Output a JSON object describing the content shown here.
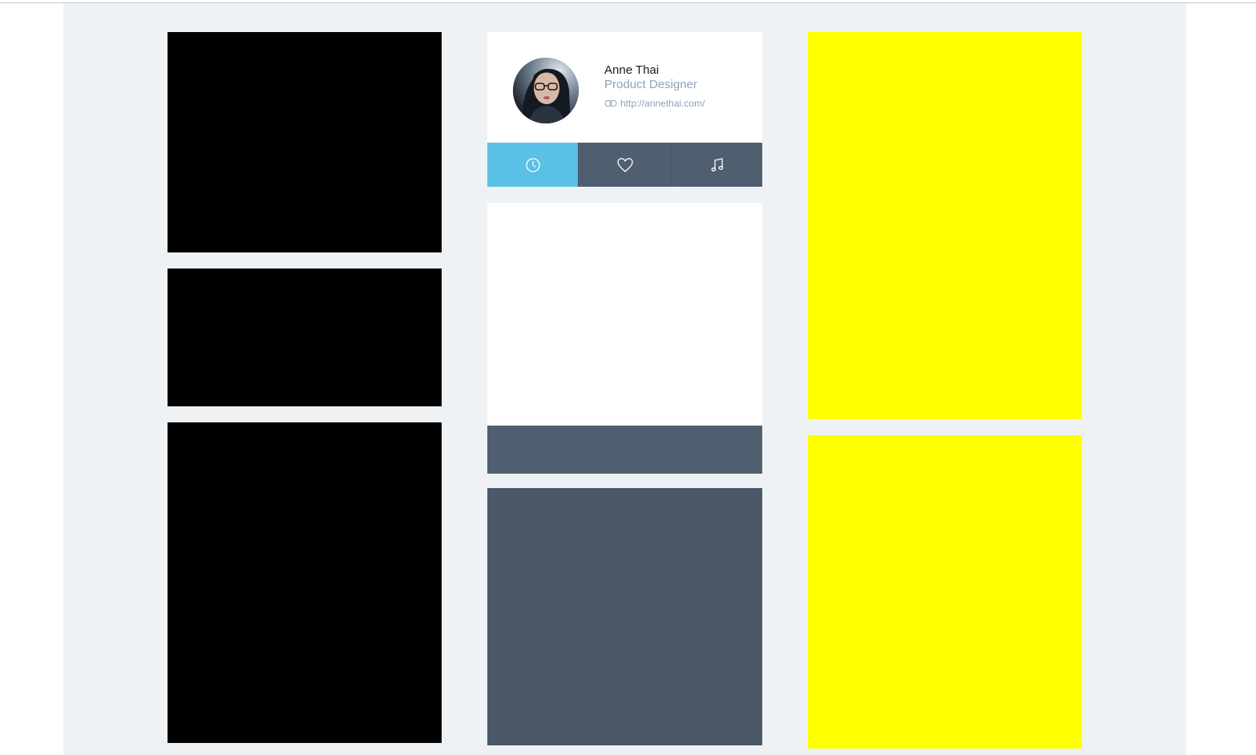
{
  "profile": {
    "name": "Anne Thai",
    "title": "Product Designer",
    "website": "http://annethai.com/",
    "avatar": "avatar-photo"
  },
  "tabs": [
    {
      "icon": "clock-icon",
      "active": true
    },
    {
      "icon": "heart-icon",
      "active": false
    },
    {
      "icon": "music-note-icon",
      "active": false
    }
  ],
  "colors": {
    "page_bg": "#eef2f5",
    "tab_active": "#5bc0e6",
    "tab_inactive": "#4f5f70",
    "card_dark": "#4a5868",
    "placeholder_black": "#000000",
    "placeholder_yellow": "#ffff00",
    "muted_text": "#8fa3b6"
  }
}
